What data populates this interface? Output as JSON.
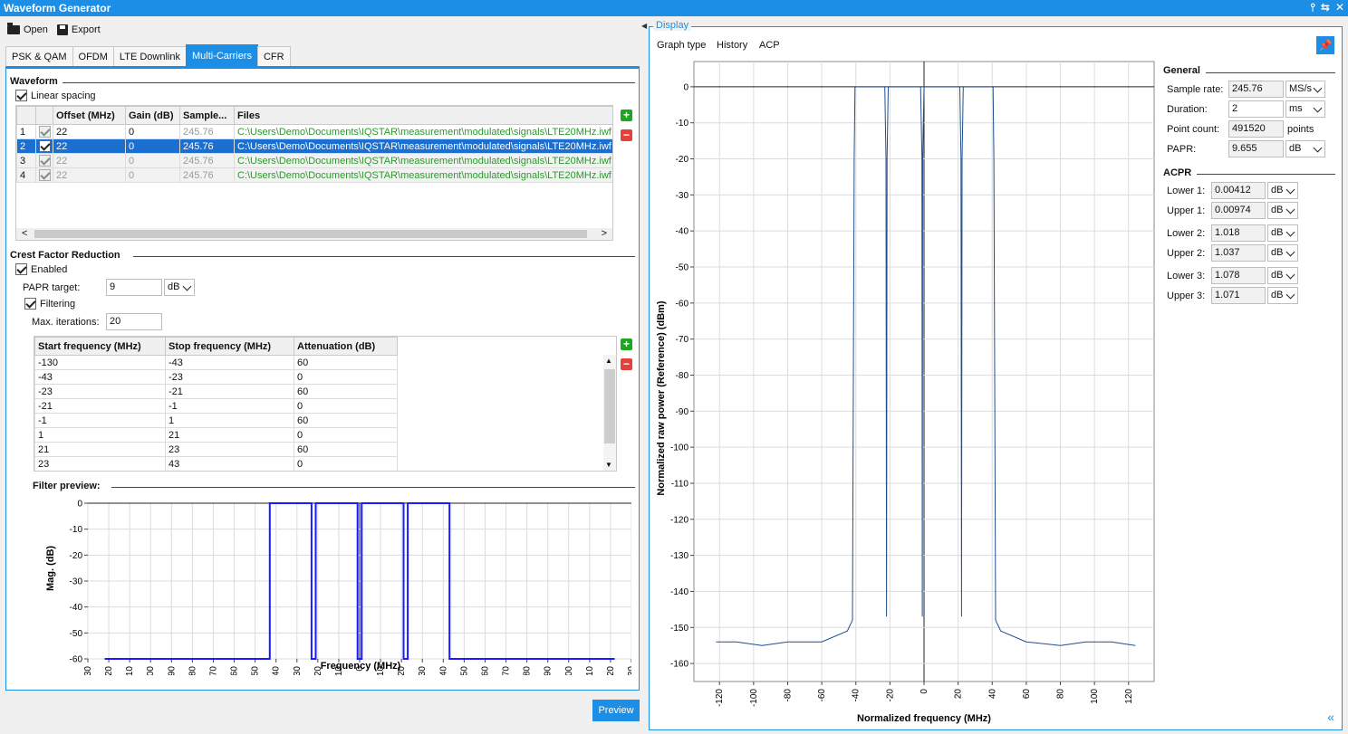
{
  "window": {
    "title": "Waveform Generator",
    "ctrl_pin": "⫯",
    "ctrl_restore": "⇆",
    "ctrl_close": "✕"
  },
  "toolbar": {
    "open_label": "Open",
    "export_label": "Export"
  },
  "tabs": [
    {
      "label": "PSK & QAM"
    },
    {
      "label": "OFDM"
    },
    {
      "label": "LTE Downlink"
    },
    {
      "label": "Multi-Carriers"
    },
    {
      "label": "CFR"
    }
  ],
  "waveform": {
    "section_title": "Waveform",
    "linear_spacing_label": "Linear spacing",
    "columns": [
      "",
      "",
      "Offset (MHz)",
      "Gain (dB)",
      "Sample...",
      "Files"
    ],
    "rows": [
      {
        "idx": "1",
        "offset": "22",
        "gain": "0",
        "sample": "245.76",
        "file": "C:\\Users\\Demo\\Documents\\IQSTAR\\measurement\\modulated\\signals\\LTE20MHz.iwf"
      },
      {
        "idx": "2",
        "offset": "22",
        "gain": "0",
        "sample": "245.76",
        "file": "C:\\Users\\Demo\\Documents\\IQSTAR\\measurement\\modulated\\signals\\LTE20MHz.iwf"
      },
      {
        "idx": "3",
        "offset": "22",
        "gain": "0",
        "sample": "245.76",
        "file": "C:\\Users\\Demo\\Documents\\IQSTAR\\measurement\\modulated\\signals\\LTE20MHz.iwf"
      },
      {
        "idx": "4",
        "offset": "22",
        "gain": "0",
        "sample": "245.76",
        "file": "C:\\Users\\Demo\\Documents\\IQSTAR\\measurement\\modulated\\signals\\LTE20MHz.iwf"
      }
    ],
    "scroll_left": "<",
    "scroll_right": ">"
  },
  "cfr": {
    "section_title": "Crest Factor Reduction",
    "enabled_label": "Enabled",
    "papr_target_label": "PAPR target:",
    "papr_target_value": "9",
    "papr_unit": "dB",
    "filtering_label": "Filtering",
    "max_iter_label": "Max. iterations:",
    "max_iter_value": "20",
    "columns": [
      "Start frequency (MHz)",
      "Stop frequency (MHz)",
      "Attenuation (dB)"
    ],
    "rows": [
      [
        "-130",
        "-43",
        "60"
      ],
      [
        "-43",
        "-23",
        "0"
      ],
      [
        "-23",
        "-21",
        "60"
      ],
      [
        "-21",
        "-1",
        "0"
      ],
      [
        "-1",
        "1",
        "60"
      ],
      [
        "1",
        "21",
        "0"
      ],
      [
        "21",
        "23",
        "60"
      ],
      [
        "23",
        "43",
        "0"
      ]
    ],
    "filter_preview_label": "Filter preview:"
  },
  "preview_button": "Preview",
  "display": {
    "legend": "Display",
    "menu": [
      "Graph type",
      "History",
      "ACP"
    ],
    "collapse_glyph": "«",
    "pin_glyph": "📌"
  },
  "general": {
    "section_title": "General",
    "sample_rate_label": "Sample rate:",
    "sample_rate_value": "245.76",
    "sample_rate_unit": "MS/s",
    "duration_label": "Duration:",
    "duration_value": "2",
    "duration_unit": "ms",
    "point_count_label": "Point count:",
    "point_count_value": "491520",
    "point_count_unit": "points",
    "papr_label": "PAPR:",
    "papr_value": "9.655",
    "papr_unit": "dB"
  },
  "acpr": {
    "section_title": "ACPR",
    "rows": [
      {
        "label": "Lower 1:",
        "value": "0.00412",
        "unit": "dB"
      },
      {
        "label": "Upper 1:",
        "value": "0.00974",
        "unit": "dB"
      },
      {
        "label": "Lower 2:",
        "value": "1.018",
        "unit": "dB"
      },
      {
        "label": "Upper 2:",
        "value": "1.037",
        "unit": "dB"
      },
      {
        "label": "Lower 3:",
        "value": "1.078",
        "unit": "dB"
      },
      {
        "label": "Upper 3:",
        "value": "1.071",
        "unit": "dB"
      }
    ]
  },
  "chart_data": [
    {
      "type": "line",
      "title": "",
      "xlabel": "Frequency (MHz)",
      "ylabel": "Mag. (dB)",
      "xlim": [
        -130,
        130
      ],
      "ylim": [
        -60,
        0
      ],
      "xticks": [
        -130,
        -120,
        -110,
        -100,
        -90,
        -80,
        -70,
        -60,
        -50,
        -40,
        -30,
        -20,
        -10,
        0,
        10,
        20,
        30,
        40,
        50,
        60,
        70,
        80,
        90,
        100,
        110,
        120,
        130
      ],
      "yticks": [
        0,
        -10,
        -20,
        -30,
        -40,
        -50,
        -60
      ],
      "grid": true,
      "color": "#1a1aff",
      "series": [
        {
          "x": [
            -122,
            -43,
            -43,
            -23,
            -23,
            -21,
            -21,
            -1,
            -1,
            1,
            1,
            21,
            21,
            23,
            23,
            43,
            43,
            122
          ],
          "y": [
            -60,
            -60,
            0,
            0,
            -60,
            -60,
            0,
            0,
            -60,
            -60,
            0,
            0,
            -60,
            -60,
            0,
            0,
            -60,
            -60
          ]
        }
      ]
    },
    {
      "type": "line",
      "title": "",
      "xlabel": "Normalized frequency (MHz)",
      "ylabel": "Normalized raw power (Reference) (dBm)",
      "xlim": [
        -135,
        135
      ],
      "ylim": [
        -165,
        7
      ],
      "xticks": [
        -120,
        -100,
        -80,
        -60,
        -40,
        -20,
        0,
        20,
        40,
        60,
        80,
        100,
        120
      ],
      "yticks": [
        0,
        -10,
        -20,
        -30,
        -40,
        -50,
        -60,
        -70,
        -80,
        -90,
        -100,
        -110,
        -120,
        -130,
        -140,
        -150,
        -160
      ],
      "grid": true,
      "color": "#1f4f8f",
      "series": [
        {
          "x": [
            -122,
            -110,
            -95,
            -80,
            -60,
            -45,
            -42,
            -41,
            -40.5,
            -40,
            -30,
            -23,
            -22.3,
            -22,
            -21.7,
            -21,
            -12,
            -2,
            -1.2,
            -1,
            -0.8,
            0,
            0.5,
            1,
            10,
            20,
            21,
            21.7,
            22,
            22.3,
            23,
            30,
            40,
            40.5,
            41,
            42,
            45,
            60,
            80,
            95,
            110,
            124
          ],
          "y": [
            -154,
            -154,
            -155,
            -154,
            -154,
            -151,
            -148,
            -20,
            0,
            0,
            0,
            0,
            -20,
            -147,
            -20,
            0,
            0,
            0,
            -20,
            -147,
            -20,
            0,
            0,
            0,
            0,
            0,
            0,
            -20,
            -147,
            -20,
            0,
            0,
            0,
            0,
            -20,
            -148,
            -151,
            -154,
            -155,
            -154,
            -154,
            -155
          ]
        }
      ]
    }
  ]
}
